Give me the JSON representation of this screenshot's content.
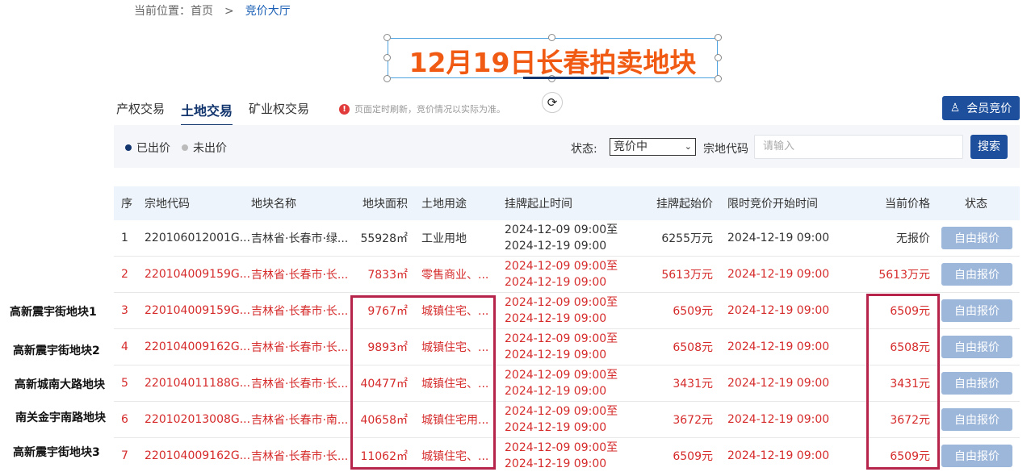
{
  "breadcrumb": {
    "prefix": "当前位置：",
    "home": "首页",
    "sep": ">",
    "current": "竞价大厅"
  },
  "title": "12月19日长春拍卖地块",
  "tabs": [
    "产权交易",
    "土地交易",
    "矿业权交易"
  ],
  "active_tab": "土地交易",
  "notice": "页面定时刷新，竞价情况以实际为准。",
  "member_button": "会员竞价",
  "legend": {
    "bid": "已出价",
    "no_bid": "未出价",
    "bid_color": "#12356e",
    "no_bid_color": "#bbbbbb"
  },
  "filter": {
    "status_label": "状态:",
    "status_value": "竞价中",
    "code_label": "宗地代码",
    "code_placeholder": "请输入",
    "search_label": "搜索"
  },
  "columns": [
    "序",
    "宗地代码",
    "地块名称",
    "地块面积",
    "土地用途",
    "挂牌起止时间",
    "挂牌起始价",
    "限时竞价开始时间",
    "当前价格",
    "状态"
  ],
  "rows": [
    {
      "no": "1",
      "code": "220106012001G...",
      "name": "吉林省·长春市·绿...",
      "area": "55928㎡",
      "use": "工业用地",
      "start": "2024-12-09 09:00至",
      "end": "2024-12-19 09:00",
      "price": "6255万元",
      "auction": "2024-12-19 09:00",
      "current": "无报价",
      "action": "自由报价",
      "red": false
    },
    {
      "no": "2",
      "code": "220104009159G...",
      "name": "吉林省·长春市·长...",
      "area": "7833㎡",
      "use": "零售商业、...",
      "start": "2024-12-09 09:00至",
      "end": "2024-12-19 09:00",
      "price": "5613万元",
      "auction": "2024-12-19 09:00",
      "current": "5613万元",
      "action": "自由报价",
      "red": true
    },
    {
      "no": "3",
      "code": "220104009159G...",
      "name": "吉林省·长春市·长...",
      "area": "9767㎡",
      "use": "城镇住宅、...",
      "start": "2024-12-09 09:00至",
      "end": "2024-12-19 09:00",
      "price": "6509元",
      "auction": "2024-12-19 09:00",
      "current": "6509元",
      "action": "自由报价",
      "red": true
    },
    {
      "no": "4",
      "code": "220104009162G...",
      "name": "吉林省·长春市·长...",
      "area": "9893㎡",
      "use": "城镇住宅、...",
      "start": "2024-12-09 09:00至",
      "end": "2024-12-19 09:00",
      "price": "6508元",
      "auction": "2024-12-19 09:00",
      "current": "6508元",
      "action": "自由报价",
      "red": true
    },
    {
      "no": "5",
      "code": "220104011188G...",
      "name": "吉林省·长春市·长...",
      "area": "40477㎡",
      "use": "城镇住宅、...",
      "start": "2024-12-09 09:00至",
      "end": "2024-12-19 09:00",
      "price": "3431元",
      "auction": "2024-12-19 09:00",
      "current": "3431元",
      "action": "自由报价",
      "red": true
    },
    {
      "no": "6",
      "code": "220102013008G...",
      "name": "吉林省·长春市·南...",
      "area": "40658㎡",
      "use": "城镇住宅用...",
      "start": "2024-12-09 09:00至",
      "end": "2024-12-19 09:00",
      "price": "3672元",
      "auction": "2024-12-19 09:00",
      "current": "3672元",
      "action": "自由报价",
      "red": true
    },
    {
      "no": "7",
      "code": "220104009162G...",
      "name": "吉林省·长春市·长...",
      "area": "11062㎡",
      "use": "城镇住宅、...",
      "start": "2024-12-09 09:00至",
      "end": "2024-12-19 09:00",
      "price": "6509元",
      "auction": "2024-12-19 09:00",
      "current": "6509元",
      "action": "自由报价",
      "red": true
    }
  ],
  "side_labels": [
    "高新震宇街地块1",
    "高新震宇街地块2",
    "高新城南大路地块",
    "南关金宇南路地块",
    "高新震宇街地块3"
  ],
  "colors": {
    "brand": "#1d4f9c",
    "accent_red": "#d62b2b",
    "title_orange": "#f05a12",
    "highlight": "#b6234b",
    "button_disabled": "#9db7da"
  }
}
